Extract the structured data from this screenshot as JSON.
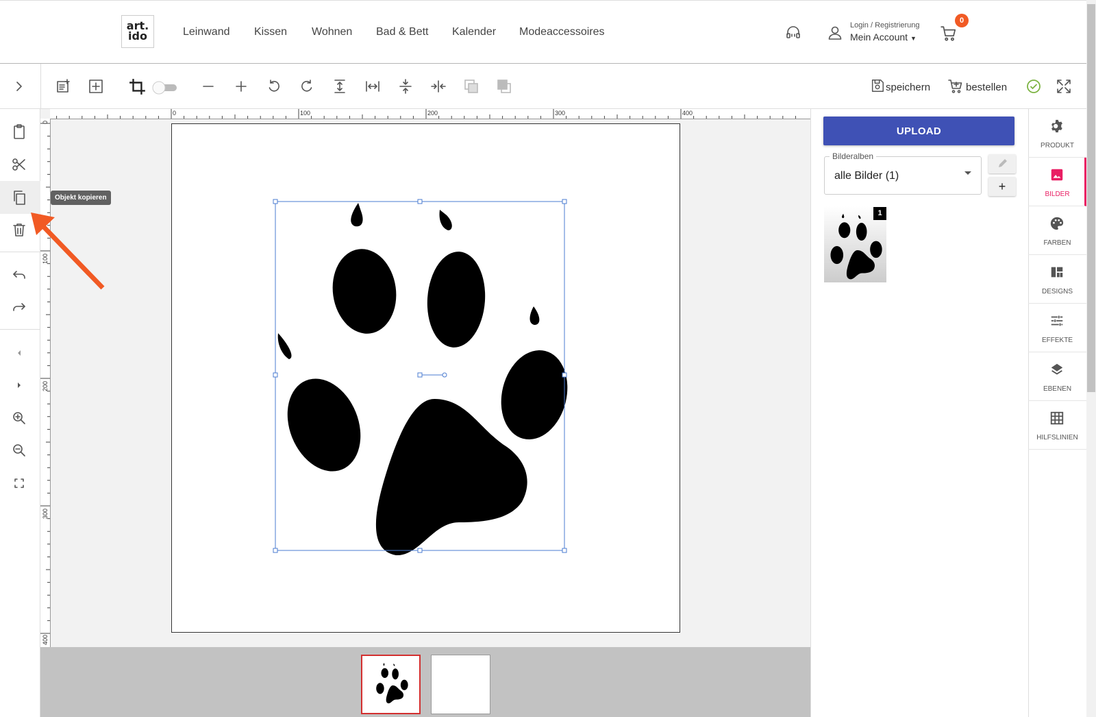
{
  "logo": {
    "line1": "art.",
    "line2": "ido"
  },
  "nav": [
    "Leinwand",
    "Kissen",
    "Wohnen",
    "Bad & Bett",
    "Kalender",
    "Modeaccessoires"
  ],
  "account": {
    "small": "Login / Registrierung",
    "main": "Mein Account"
  },
  "cart": {
    "count": "0"
  },
  "toolbar": {
    "save_label": "speichern",
    "order_label": "bestellen"
  },
  "tooltip": "Objekt kopieren",
  "ruler": {
    "top": [
      "0",
      "100",
      "200",
      "300",
      "400"
    ],
    "left": [
      "0",
      "100",
      "200",
      "300",
      "400"
    ]
  },
  "right_panel": {
    "upload_label": "UPLOAD",
    "albums_legend": "Bilderalben",
    "albums_value": "alle Bilder (1)",
    "add_label": "+",
    "image_count": "1"
  },
  "right_nav": [
    "PRODUKT",
    "BILDER",
    "FARBEN",
    "DESIGNS",
    "EFFEKTE",
    "EBENEN",
    "HILFSLINIEN"
  ],
  "colors": {
    "accent": "#3f51b5",
    "active": "#e91e63",
    "badge": "#f15a24",
    "arrow": "#f15a24"
  }
}
